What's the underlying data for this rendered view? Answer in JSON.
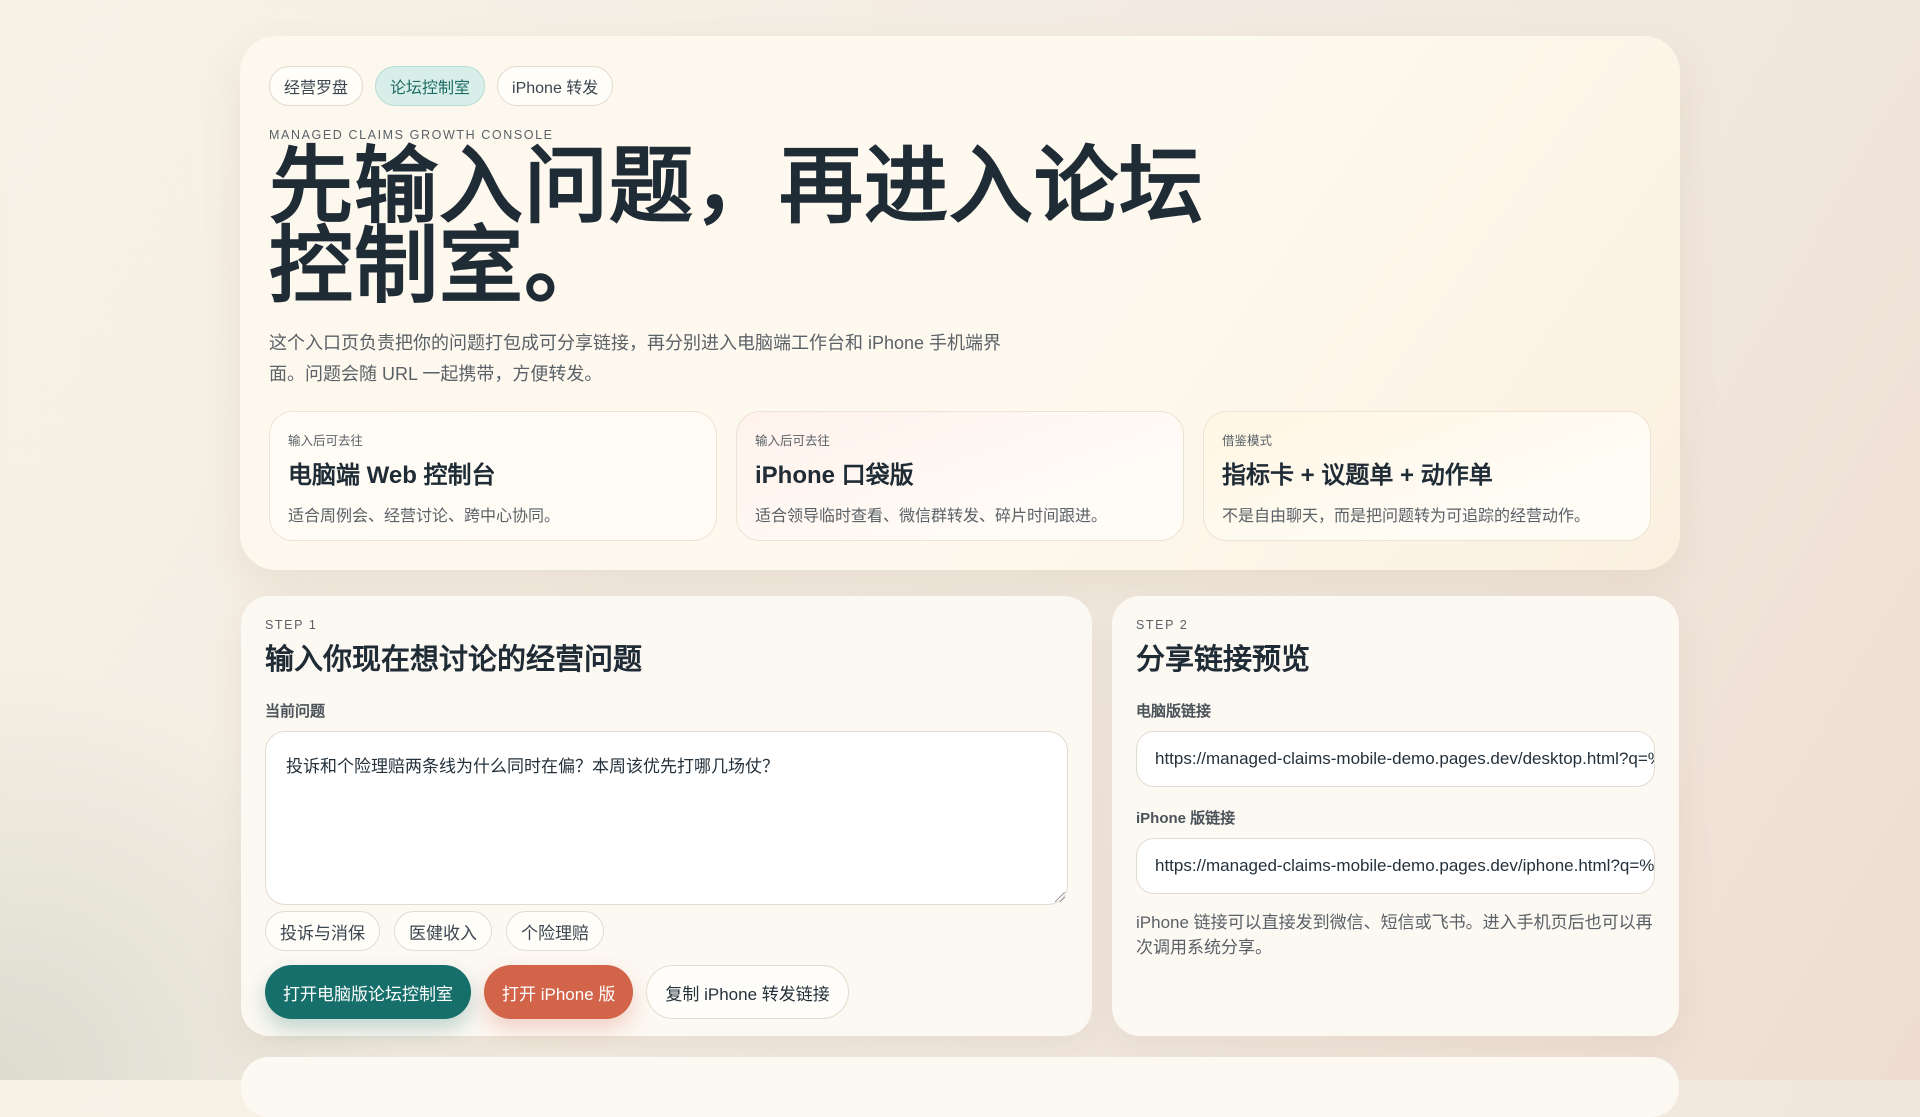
{
  "hero": {
    "nav_chips": [
      {
        "label": "经营罗盘",
        "active": false
      },
      {
        "label": "论坛控制室",
        "active": true
      },
      {
        "label": "iPhone 转发",
        "active": false
      }
    ],
    "eyebrow": "MANAGED CLAIMS GROWTH CONSOLE",
    "headline_line1": "先输入问题，再进入论坛",
    "headline_line2": "控制室。",
    "lede": "这个入口页负责把你的问题打包成可分享链接，再分别进入电脑端工作台和 iPhone 手机端界面。问题会随 URL 一起携带，方便转发。",
    "cards": [
      {
        "kicker": "输入后可去往",
        "title": "电脑端 Web 控制台",
        "desc": "适合周例会、经营讨论、跨中心协同。"
      },
      {
        "kicker": "输入后可去往",
        "title": "iPhone 口袋版",
        "desc": "适合领导临时查看、微信群转发、碎片时间跟进。"
      },
      {
        "kicker": "借鉴模式",
        "title": "指标卡 + 议题单 + 动作单",
        "desc": "不是自由聊天，而是把问题转为可追踪的经营动作。"
      }
    ]
  },
  "step1": {
    "step": "STEP 1",
    "title": "输入你现在想讨论的经营问题",
    "field_label": "当前问题",
    "question_value": "投诉和个险理赔两条线为什么同时在偏？本周该优先打哪几场仗？",
    "tags": [
      "投诉与消保",
      "医健收入",
      "个险理赔"
    ],
    "buttons": {
      "open_desktop": "打开电脑版论坛控制室",
      "open_iphone": "打开 iPhone 版",
      "copy_iphone": "复制 iPhone 转发链接"
    }
  },
  "step2": {
    "step": "STEP 2",
    "title": "分享链接预览",
    "desktop_label": "电脑版链接",
    "desktop_url": "https://managed-claims-mobile-demo.pages.dev/desktop.html?q=%",
    "iphone_label": "iPhone 版链接",
    "iphone_url": "https://managed-claims-mobile-demo.pages.dev/iphone.html?q=%E",
    "note": "iPhone 链接可以直接发到微信、短信或飞书。进入手机页后也可以再次调用系统分享。"
  },
  "colors": {
    "accent_teal": "#166f6a",
    "accent_warm": "#d2644a",
    "text_dark": "#1f2b35"
  }
}
